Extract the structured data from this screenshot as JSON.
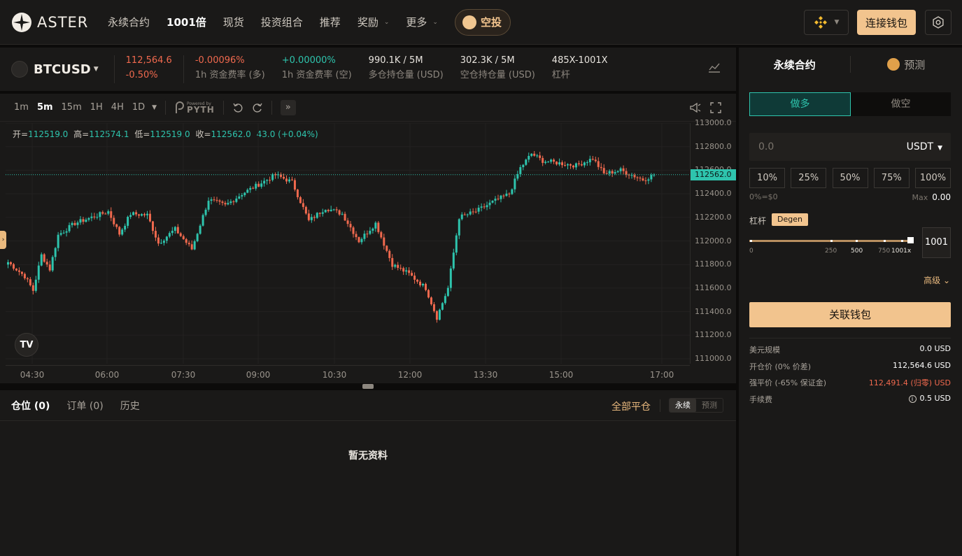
{
  "header": {
    "brand": "ASTER",
    "nav": [
      {
        "label": "永续合约",
        "active": false,
        "dropdown": false
      },
      {
        "label": "1001倍",
        "active": true,
        "dropdown": false
      },
      {
        "label": "现货",
        "active": false,
        "dropdown": false
      },
      {
        "label": "投资组合",
        "active": false,
        "dropdown": false
      },
      {
        "label": "推荐",
        "active": false,
        "dropdown": false
      },
      {
        "label": "奖励",
        "active": false,
        "dropdown": true
      },
      {
        "label": "更多",
        "active": false,
        "dropdown": true
      }
    ],
    "airdrop_label": "空投",
    "connect_label": "连接钱包",
    "chain_icon": "bnb-chain-icon",
    "accent": "#f2c48e"
  },
  "ticker": {
    "symbol": "BTCUSD",
    "price": "112,564.6",
    "change": "-0.50%",
    "stats": [
      {
        "value": "-0.00096%",
        "label": "1h 资金费率 (多)",
        "color": "red"
      },
      {
        "value": "+0.00000%",
        "label": "1h 资金费率 (空)",
        "color": "green"
      },
      {
        "value": "990.1K / 5M",
        "label": "多仓持仓量 (USD)",
        "color": ""
      },
      {
        "value": "302.3K / 5M",
        "label": "空仓持仓量 (USD)",
        "color": ""
      },
      {
        "value": "485X-1001X",
        "label": "杠杆",
        "color": ""
      }
    ]
  },
  "chart_toolbar": {
    "timeframes": [
      "1m",
      "5m",
      "15m",
      "1H",
      "4H",
      "1D"
    ],
    "active_timeframe": "5m",
    "pyth_small": "Powered by",
    "pyth_big": "PYTH"
  },
  "ohlc": {
    "open_label": "开=",
    "open": "112519.0",
    "high_label": "高=",
    "high": "112574.1",
    "low_label": "低=",
    "low": "112519.0",
    "close_label": "收=",
    "close": "112562.0",
    "change": "43.0 (+0.04%)"
  },
  "chart_data": {
    "type": "candlestick",
    "yticks": [
      113000,
      112800,
      112600,
      112400,
      112200,
      112000,
      111800,
      111600,
      111400,
      111200,
      111000
    ],
    "ytick_labels": [
      "113000.0",
      "112800.0",
      "112600.0",
      "112400.0",
      "112200.0",
      "112000.0",
      "111800.0",
      "111600.0",
      "111400.0",
      "111200.0",
      "111000.0"
    ],
    "xtick_labels": [
      "04:30",
      "06:00",
      "07:30",
      "09:00",
      "10:30",
      "12:00",
      "13:30",
      "15:00",
      "17:00"
    ],
    "ylim": [
      111000,
      113000
    ],
    "last_price": 112562.0,
    "last_price_label": "112562.0",
    "up_color": "#2ec4ad",
    "down_color": "#f0694e",
    "anchors": [
      [
        0,
        111820
      ],
      [
        6,
        111700
      ],
      [
        9,
        111580
      ],
      [
        12,
        111880
      ],
      [
        15,
        111760
      ],
      [
        18,
        112050
      ],
      [
        24,
        112150
      ],
      [
        30,
        112200
      ],
      [
        36,
        112250
      ],
      [
        40,
        112060
      ],
      [
        44,
        112230
      ],
      [
        50,
        112220
      ],
      [
        54,
        111980
      ],
      [
        60,
        112100
      ],
      [
        66,
        111930
      ],
      [
        72,
        112350
      ],
      [
        78,
        112300
      ],
      [
        84,
        112400
      ],
      [
        90,
        112480
      ],
      [
        96,
        112560
      ],
      [
        102,
        112500
      ],
      [
        108,
        112170
      ],
      [
        114,
        112280
      ],
      [
        120,
        112230
      ],
      [
        126,
        112000
      ],
      [
        132,
        112150
      ],
      [
        138,
        111800
      ],
      [
        144,
        111720
      ],
      [
        150,
        111600
      ],
      [
        154,
        111350
      ],
      [
        158,
        111600
      ],
      [
        162,
        112200
      ],
      [
        168,
        112250
      ],
      [
        174,
        112330
      ],
      [
        180,
        112400
      ],
      [
        184,
        112620
      ],
      [
        188,
        112740
      ],
      [
        192,
        112680
      ],
      [
        198,
        112660
      ],
      [
        204,
        112640
      ],
      [
        210,
        112700
      ],
      [
        214,
        112570
      ],
      [
        220,
        112600
      ],
      [
        228,
        112520
      ],
      [
        232,
        112560
      ]
    ]
  },
  "positions": {
    "tabs": [
      "仓位 (0)",
      "订单 (0)",
      "历史"
    ],
    "close_all": "全部平仓",
    "seg": [
      "永续",
      "预测"
    ],
    "empty": "暂无资料"
  },
  "order": {
    "tabs": [
      "永续合约",
      "预测"
    ],
    "long": "做多",
    "short": "做空",
    "amount_placeholder": "0.0",
    "currency": "USDT",
    "percents": [
      "10%",
      "25%",
      "50%",
      "75%",
      "100%"
    ],
    "pct_info": "0%=$0",
    "max_label": "Max",
    "max_value": "0.00",
    "leverage_label": "杠杆",
    "degen": "Degen",
    "lev_ticks": [
      "0",
      "250",
      "500",
      "750",
      "1001x"
    ],
    "leverage_value": "1001",
    "advanced": "高级",
    "main_button": "关联钱包",
    "info": [
      {
        "k": "美元规模",
        "v": "0.0 USD",
        "color": ""
      },
      {
        "k": "开仓价 (0% 价差)",
        "v": "112,564.6 USD",
        "color": ""
      },
      {
        "k": "强平价 (-65% 保证金)",
        "v": "112,491.4 (归零) USD",
        "color": "red"
      },
      {
        "k": "手续费",
        "v": "0.5 USD",
        "color": ""
      }
    ]
  }
}
